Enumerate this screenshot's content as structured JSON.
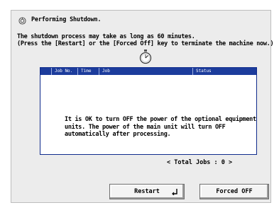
{
  "header": {
    "title": "Performing Shutdown.",
    "icon": "shutdown-status-icon"
  },
  "message": {
    "line1": "The shutdown process may take as long as 60 minutes.",
    "line2": "(Press the [Restart] or the [Forced Off] key to terminate the machine now.)"
  },
  "table": {
    "columns": [
      "Job No.",
      "Time",
      "Job",
      "Status"
    ],
    "body_text": "It is OK to turn OFF the power of the optional equipment\nunits. The power of the main unit will turn OFF\nautomatically after processing."
  },
  "footer": {
    "total_label": "Total Jobs :",
    "total_value": "0"
  },
  "buttons": {
    "restart": "Restart",
    "forced_off": "Forced OFF"
  },
  "colors": {
    "header_blue": "#1c3c9c",
    "panel_bg": "#ececec"
  }
}
